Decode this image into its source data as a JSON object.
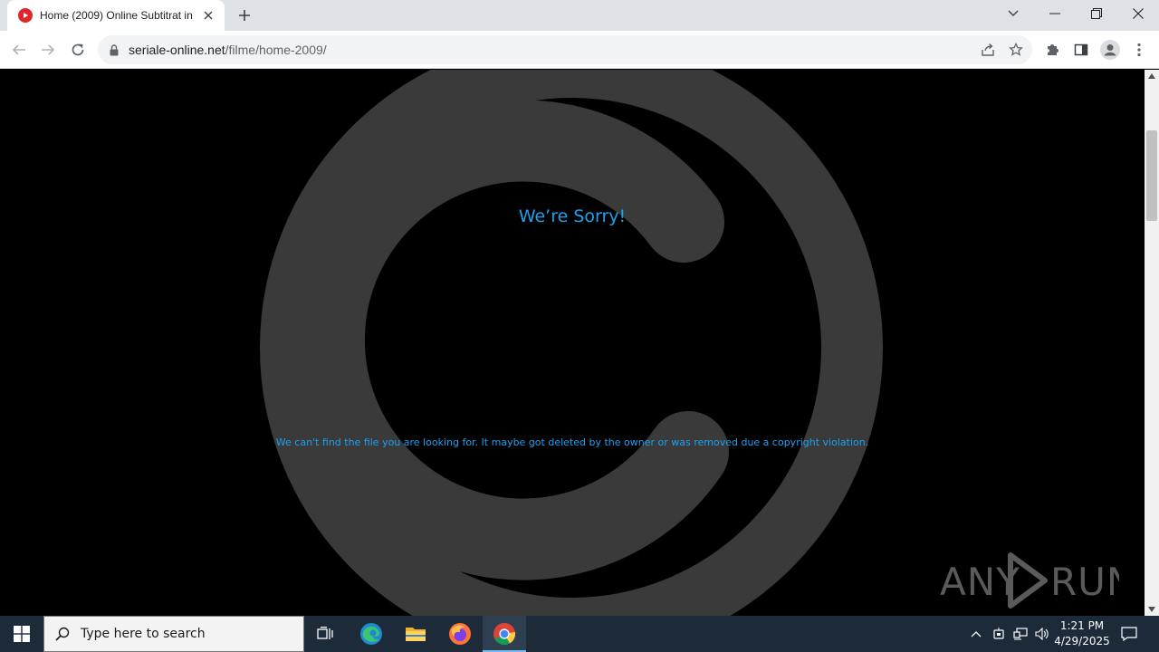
{
  "browser": {
    "tab_title": "Home (2009) Online Subtitrat in",
    "url_domain": "seriale-online.net",
    "url_path": "/filme/home-2009/",
    "window_controls": [
      "minimize",
      "restore",
      "close"
    ]
  },
  "page": {
    "title": "We’re Sorry!",
    "message": "We can't find the file you are looking for. It maybe got deleted by the owner or was removed due a copyright violation.",
    "accent_color": "#1ea0f0",
    "art_color": "#3a3a3a",
    "watermark_text": "ANY RUN"
  },
  "taskbar": {
    "search_placeholder": "Type here to search",
    "apps": [
      "task-view",
      "edge",
      "file-explorer",
      "firefox",
      "chrome"
    ],
    "active_app": "chrome",
    "time": "1:21 PM",
    "date": "4/29/2025"
  }
}
